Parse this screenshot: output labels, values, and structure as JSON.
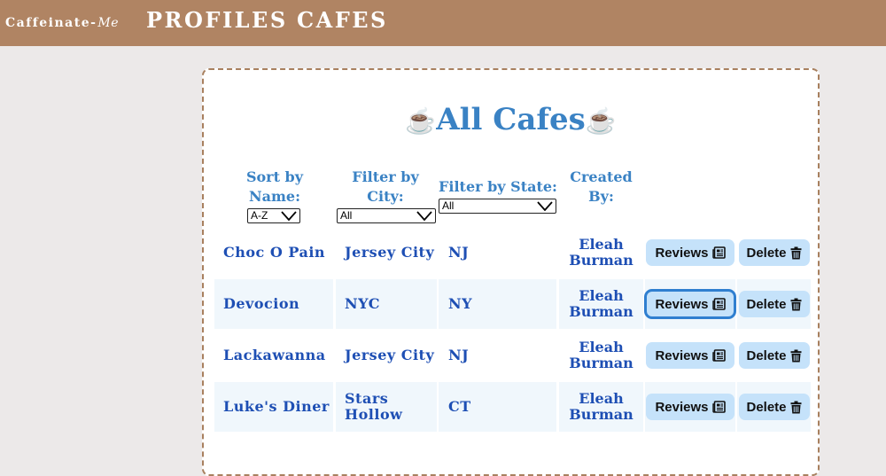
{
  "nav": {
    "brand_main": "Caffeinate-",
    "brand_script": "Me",
    "links": [
      "PROFILES",
      "CAFES"
    ]
  },
  "page": {
    "title": "All Cafes",
    "title_icon": "☕"
  },
  "filters": {
    "sort_label_1": "Sort by",
    "sort_label_2": "Name:",
    "sort_value": "A-Z",
    "city_label_1": "Filter by",
    "city_label_2": "City:",
    "city_value": "All",
    "state_label": "Filter by State:",
    "state_value": "All",
    "created_label_1": "Created",
    "created_label_2": "By:"
  },
  "buttons": {
    "reviews": "Reviews",
    "delete": "Delete"
  },
  "cafes": [
    {
      "name": "Choc O Pain",
      "city": "Jersey City",
      "state": "NJ",
      "by_first": "Eleah",
      "by_last": "Burman"
    },
    {
      "name": "Devocion",
      "city": "NYC",
      "state": "NY",
      "by_first": "Eleah",
      "by_last": "Burman"
    },
    {
      "name": "Lackawanna",
      "city": "Jersey City",
      "state": "NJ",
      "by_first": "Eleah",
      "by_last": "Burman"
    },
    {
      "name": "Luke's Diner",
      "city": "Stars Hollow",
      "state": "CT",
      "by_first": "Eleah",
      "by_last": "Burman"
    }
  ],
  "colors": {
    "navbar": "#b08463",
    "accent": "#3a82c4",
    "text": "#1e4fb4",
    "button": "#c5e2fa"
  }
}
